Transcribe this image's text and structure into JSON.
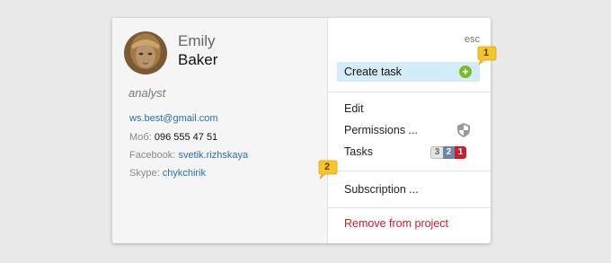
{
  "profile": {
    "first_name": "Emily",
    "last_name": "Baker",
    "role": "analyst",
    "email": "ws.best@gmail.com",
    "phone_label": "Моб:",
    "phone": "096 555 47 51",
    "facebook_label": "Facebook:",
    "facebook": "svetik.rizhskaya",
    "skype_label": "Skype:",
    "skype": "chykchirik"
  },
  "menu": {
    "esc_label": "esc",
    "create_task": "Create task",
    "edit": "Edit",
    "permissions": "Permissions ...",
    "tasks": "Tasks",
    "tasks_counts": [
      "3",
      "2",
      "1"
    ],
    "subscription": "Subscription ...",
    "remove": "Remove from project"
  },
  "markers": [
    "1",
    "2"
  ],
  "colors": {
    "highlight": "#d4ebf8",
    "link": "#2a6fb0",
    "danger": "#c8202a",
    "add": "#7cbc2a",
    "marker": "#f6c52b"
  },
  "icons": [
    "avatar-image",
    "plus-icon",
    "shield-icon"
  ]
}
